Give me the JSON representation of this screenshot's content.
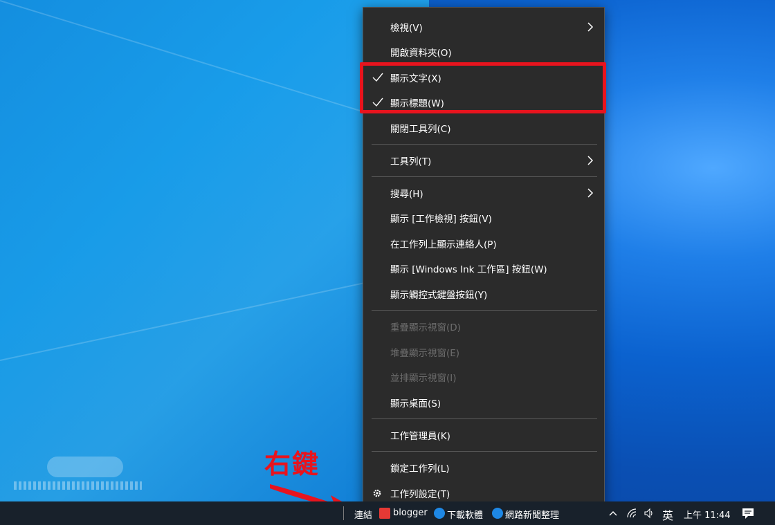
{
  "menu": {
    "items": [
      {
        "label": "檢視(V)",
        "submenu": true
      },
      {
        "label": "開啟資料夾(O)"
      },
      {
        "label": "顯示文字(X)",
        "checked": true
      },
      {
        "label": "顯示標題(W)",
        "checked": true
      },
      {
        "label": "關閉工具列(C)"
      },
      {
        "label": "工具列(T)",
        "submenu": true
      },
      {
        "label": "搜尋(H)",
        "submenu": true
      },
      {
        "label": "顯示 [工作檢視] 按鈕(V)"
      },
      {
        "label": "在工作列上顯示連絡人(P)"
      },
      {
        "label": "顯示 [Windows Ink 工作區] 按鈕(W)"
      },
      {
        "label": "顯示觸控式鍵盤按鈕(Y)"
      },
      {
        "label": "重疊顯示視窗(D)",
        "disabled": true
      },
      {
        "label": "堆疊顯示視窗(E)",
        "disabled": true
      },
      {
        "label": "並排顯示視窗(I)",
        "disabled": true
      },
      {
        "label": "顯示桌面(S)"
      },
      {
        "label": "工作管理員(K)"
      },
      {
        "label": "鎖定工作列(L)"
      },
      {
        "label": "工作列設定(T)",
        "icon": "gear-icon"
      }
    ]
  },
  "annotation": {
    "text": "右鍵",
    "color": "#e8141e"
  },
  "taskbar": {
    "links_label": "連結",
    "apps": [
      {
        "label": "blogger",
        "icon": "blogger-icon"
      },
      {
        "label": "下載軟體",
        "icon": "edge-icon"
      },
      {
        "label": "網路新聞整理",
        "icon": "edge-icon"
      }
    ],
    "ime": "英",
    "clock": "上午 11:44"
  },
  "colors": {
    "menu_bg": "#2b2b2b",
    "highlight": "#e8141e",
    "taskbar_bg": "#18212b"
  }
}
